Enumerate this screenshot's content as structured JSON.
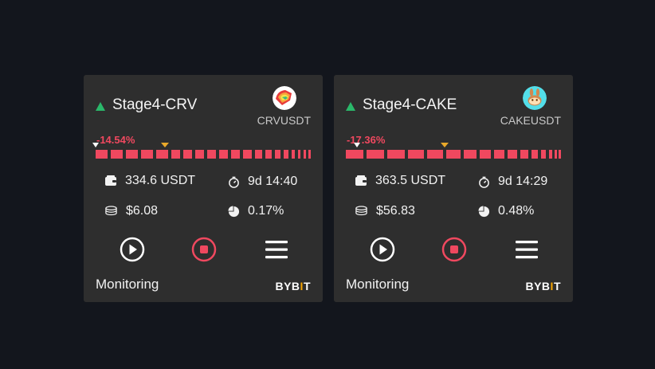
{
  "colors": {
    "background": "#13161d",
    "card": "#2e2e2e",
    "accent_red": "#f0485f",
    "up_green": "#2ab86a",
    "marker_gold": "#e9a92a",
    "bybit_orange": "#f7a600"
  },
  "bots": [
    {
      "title": "Stage4-CRV",
      "symbol": "CRVUSDT",
      "coin_icon": "crv-logo-icon",
      "pnl_percent": "-14.54%",
      "investment": "334.6 USDT",
      "runtime": "9d 14:40",
      "profit": "$6.08",
      "profit_ratio": "0.17%",
      "status": "Monitoring",
      "exchange_left": "BYB",
      "exchange_mid": "I",
      "exchange_right": "T"
    },
    {
      "title": "Stage4-CAKE",
      "symbol": "CAKEUSDT",
      "coin_icon": "cake-logo-icon",
      "pnl_percent": "-17.36%",
      "investment": "363.5 USDT",
      "runtime": "9d 14:29",
      "profit": "$56.83",
      "profit_ratio": "0.48%",
      "status": "Monitoring",
      "exchange_left": "BYB",
      "exchange_mid": "I",
      "exchange_right": "T"
    }
  ]
}
